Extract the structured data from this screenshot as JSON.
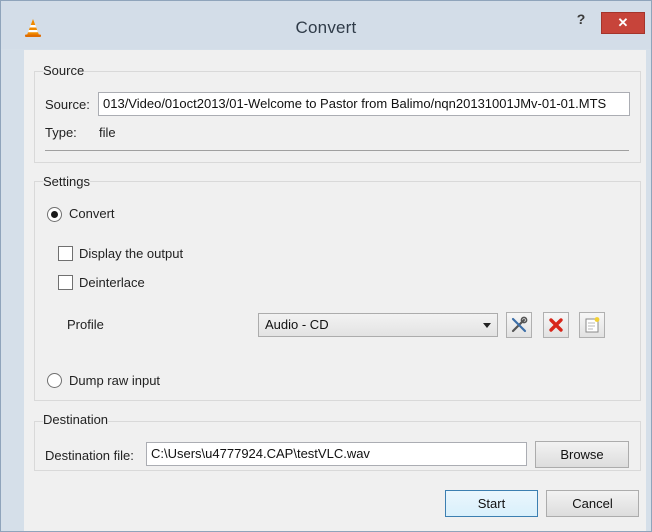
{
  "window": {
    "title": "Convert",
    "help_glyph": "?",
    "close_glyph": "✕"
  },
  "source": {
    "group_title": "Source",
    "source_label": "Source:",
    "source_value": "013/Video/01oct2013/01-Welcome to Pastor from Balimo/nqn20131001JMv-01-01.MTS",
    "type_label": "Type:",
    "type_value": "file"
  },
  "settings": {
    "group_title": "Settings",
    "convert_label": "Convert",
    "convert_selected": true,
    "display_output_label": "Display the output",
    "display_output_checked": false,
    "deinterlace_label": "Deinterlace",
    "deinterlace_checked": false,
    "profile_label": "Profile",
    "profile_value": "Audio - CD",
    "dump_raw_label": "Dump raw input",
    "dump_raw_selected": false
  },
  "destination": {
    "group_title": "Destination",
    "file_label": "Destination file:",
    "file_value": "C:\\Users\\u4777924.CAP\\testVLC.wav",
    "browse_label": "Browse"
  },
  "buttons": {
    "start_label": "Start",
    "cancel_label": "Cancel"
  },
  "icons": {
    "app": "vlc-cone-icon",
    "edit_profile": "wrench-screwdriver-icon",
    "delete_profile": "red-x-icon",
    "new_profile": "new-document-icon"
  },
  "colors": {
    "close_button": "#c7443a",
    "default_button_border": "#3c7fb1",
    "delete_icon": "#d8261a",
    "vlc_orange": "#f08a00"
  }
}
